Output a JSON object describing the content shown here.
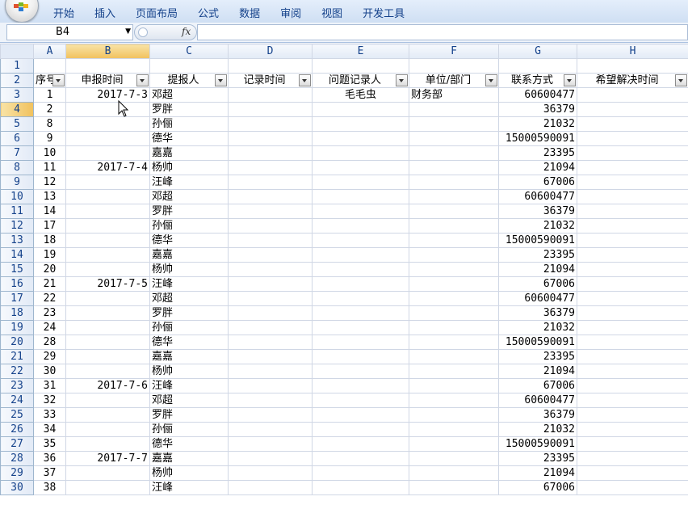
{
  "ribbon": {
    "tabs": [
      "开始",
      "插入",
      "页面布局",
      "公式",
      "数据",
      "审阅",
      "视图",
      "开发工具"
    ]
  },
  "formula_bar": {
    "name_box": "B4",
    "fx_label": "fx",
    "formula": ""
  },
  "columns": [
    "A",
    "B",
    "C",
    "D",
    "E",
    "F",
    "G",
    "H"
  ],
  "header_row": {
    "row_num": "2",
    "cells": [
      "序号",
      "申报时间",
      "提报人",
      "记录时间",
      "问题记录人",
      "单位/部门",
      "联系方式",
      "希望解决时间"
    ]
  },
  "rows": [
    {
      "n": "3",
      "seq": "1",
      "date": "2017-7-3",
      "name": "邓超",
      "rec": "毛毛虫",
      "dept": "财务部",
      "phone": "60600477"
    },
    {
      "n": "4",
      "seq": "2",
      "date": "",
      "name": "罗胖",
      "rec": "",
      "dept": "",
      "phone": "36379"
    },
    {
      "n": "5",
      "seq": "8",
      "date": "",
      "name": "孙俪",
      "rec": "",
      "dept": "",
      "phone": "21032"
    },
    {
      "n": "6",
      "seq": "9",
      "date": "",
      "name": "德华",
      "rec": "",
      "dept": "",
      "phone": "15000590091"
    },
    {
      "n": "7",
      "seq": "10",
      "date": "",
      "name": "嘉嘉",
      "rec": "",
      "dept": "",
      "phone": "23395"
    },
    {
      "n": "8",
      "seq": "11",
      "date": "2017-7-4",
      "name": "杨帅",
      "rec": "",
      "dept": "",
      "phone": "21094"
    },
    {
      "n": "9",
      "seq": "12",
      "date": "",
      "name": "汪峰",
      "rec": "",
      "dept": "",
      "phone": "67006"
    },
    {
      "n": "10",
      "seq": "13",
      "date": "",
      "name": "邓超",
      "rec": "",
      "dept": "",
      "phone": "60600477"
    },
    {
      "n": "11",
      "seq": "14",
      "date": "",
      "name": "罗胖",
      "rec": "",
      "dept": "",
      "phone": "36379"
    },
    {
      "n": "12",
      "seq": "17",
      "date": "",
      "name": "孙俪",
      "rec": "",
      "dept": "",
      "phone": "21032"
    },
    {
      "n": "13",
      "seq": "18",
      "date": "",
      "name": "德华",
      "rec": "",
      "dept": "",
      "phone": "15000590091"
    },
    {
      "n": "14",
      "seq": "19",
      "date": "",
      "name": "嘉嘉",
      "rec": "",
      "dept": "",
      "phone": "23395"
    },
    {
      "n": "15",
      "seq": "20",
      "date": "",
      "name": "杨帅",
      "rec": "",
      "dept": "",
      "phone": "21094"
    },
    {
      "n": "16",
      "seq": "21",
      "date": "2017-7-5",
      "name": "汪峰",
      "rec": "",
      "dept": "",
      "phone": "67006"
    },
    {
      "n": "17",
      "seq": "22",
      "date": "",
      "name": "邓超",
      "rec": "",
      "dept": "",
      "phone": "60600477"
    },
    {
      "n": "18",
      "seq": "23",
      "date": "",
      "name": "罗胖",
      "rec": "",
      "dept": "",
      "phone": "36379"
    },
    {
      "n": "19",
      "seq": "24",
      "date": "",
      "name": "孙俪",
      "rec": "",
      "dept": "",
      "phone": "21032"
    },
    {
      "n": "20",
      "seq": "28",
      "date": "",
      "name": "德华",
      "rec": "",
      "dept": "",
      "phone": "15000590091"
    },
    {
      "n": "21",
      "seq": "29",
      "date": "",
      "name": "嘉嘉",
      "rec": "",
      "dept": "",
      "phone": "23395"
    },
    {
      "n": "22",
      "seq": "30",
      "date": "",
      "name": "杨帅",
      "rec": "",
      "dept": "",
      "phone": "21094"
    },
    {
      "n": "23",
      "seq": "31",
      "date": "2017-7-6",
      "name": "汪峰",
      "rec": "",
      "dept": "",
      "phone": "67006"
    },
    {
      "n": "24",
      "seq": "32",
      "date": "",
      "name": "邓超",
      "rec": "",
      "dept": "",
      "phone": "60600477"
    },
    {
      "n": "25",
      "seq": "33",
      "date": "",
      "name": "罗胖",
      "rec": "",
      "dept": "",
      "phone": "36379"
    },
    {
      "n": "26",
      "seq": "34",
      "date": "",
      "name": "孙俪",
      "rec": "",
      "dept": "",
      "phone": "21032"
    },
    {
      "n": "27",
      "seq": "35",
      "date": "",
      "name": "德华",
      "rec": "",
      "dept": "",
      "phone": "15000590091"
    },
    {
      "n": "28",
      "seq": "36",
      "date": "2017-7-7",
      "name": "嘉嘉",
      "rec": "",
      "dept": "",
      "phone": "23395"
    },
    {
      "n": "29",
      "seq": "37",
      "date": "",
      "name": "杨帅",
      "rec": "",
      "dept": "",
      "phone": "21094"
    },
    {
      "n": "30",
      "seq": "38",
      "date": "",
      "name": "汪峰",
      "rec": "",
      "dept": "",
      "phone": "67006"
    }
  ],
  "selected": {
    "col": "B",
    "row": "4"
  }
}
